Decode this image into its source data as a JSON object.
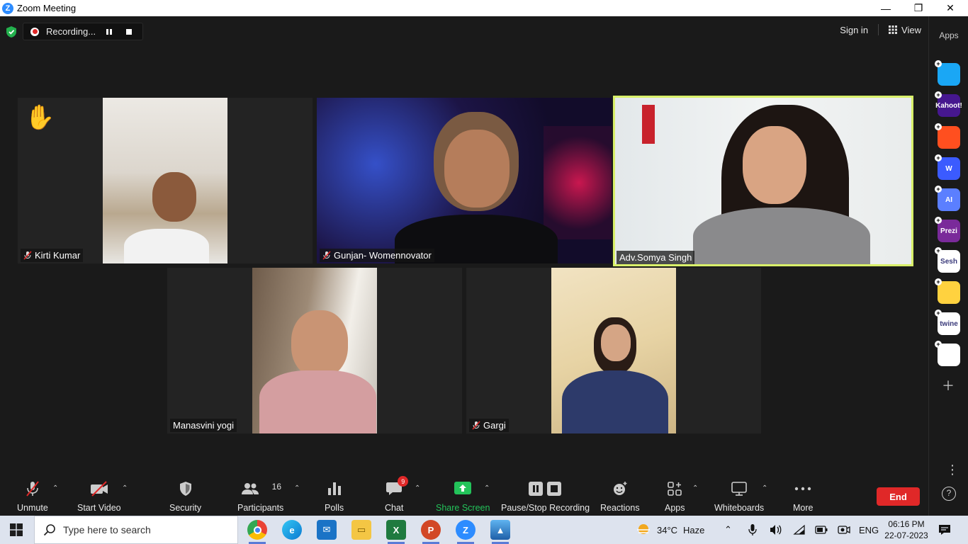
{
  "window": {
    "title": "Zoom Meeting",
    "minimize": "—",
    "restore": "❐",
    "close": "✕"
  },
  "topbar": {
    "recording_label": "Recording...",
    "sign_in": "Sign in",
    "view": "View"
  },
  "participants": [
    {
      "name": "Kirti Kumar",
      "muted": true,
      "hand_raised": true
    },
    {
      "name": "Gunjan- Womennovator",
      "muted": true
    },
    {
      "name": "Adv.Somya Singh",
      "muted": false,
      "active_speaker": true
    },
    {
      "name": "Manasvini yogi",
      "muted": false
    },
    {
      "name": "Gargi",
      "muted": true
    }
  ],
  "toolbar": {
    "unmute": "Unmute",
    "start_video": "Start Video",
    "security": "Security",
    "participants": "Participants",
    "participants_count": "16",
    "polls": "Polls",
    "chat": "Chat",
    "chat_badge": "9",
    "share_screen": "Share Screen",
    "pause_stop_recording": "Pause/Stop Recording",
    "reactions": "Reactions",
    "apps": "Apps",
    "whiteboards": "Whiteboards",
    "more": "More",
    "end": "End"
  },
  "apps_panel": {
    "title": "Apps",
    "items": [
      {
        "label": "",
        "color": "#1aa7f5"
      },
      {
        "label": "Kahoot!",
        "color": "#46178f"
      },
      {
        "label": "",
        "color": "#ff4f1f"
      },
      {
        "label": "W",
        "color": "#3b5bff"
      },
      {
        "label": "AI",
        "color": "#5b7fff"
      },
      {
        "label": "Prezi",
        "color": "#7a2a9a"
      },
      {
        "label": "Sesh",
        "color": "#ffffff"
      },
      {
        "label": "",
        "color": "#ffd23f"
      },
      {
        "label": "twine",
        "color": "#ffffff"
      },
      {
        "label": "",
        "color": "#ffffff"
      }
    ]
  },
  "taskbar": {
    "search_placeholder": "Type here to search",
    "weather_temp": "34°C",
    "weather_desc": "Haze",
    "language": "ENG",
    "time": "06:16 PM",
    "date": "22-07-2023"
  }
}
